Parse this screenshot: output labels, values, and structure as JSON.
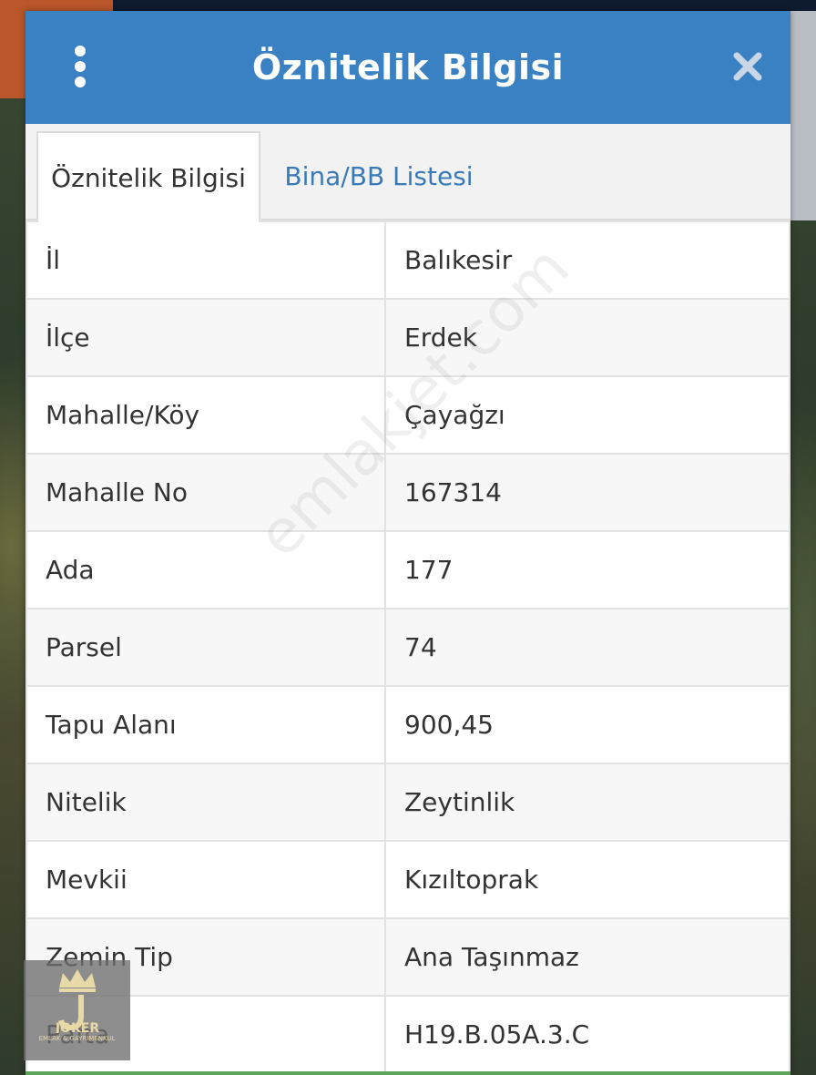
{
  "dialog": {
    "title": "Öznitelik Bilgisi",
    "tabs": [
      {
        "label": "Öznitelik Bilgisi",
        "active": true
      },
      {
        "label": "Bina/BB Listesi",
        "active": false
      }
    ],
    "rows": [
      {
        "key": "İl",
        "value": "Balıkesir"
      },
      {
        "key": "İlçe",
        "value": "Erdek"
      },
      {
        "key": "Mahalle/Köy",
        "value": "Çayağzı"
      },
      {
        "key": "Mahalle No",
        "value": "167314"
      },
      {
        "key": "Ada",
        "value": "177"
      },
      {
        "key": "Parsel",
        "value": "74"
      },
      {
        "key": "Tapu Alanı",
        "value": "900,45"
      },
      {
        "key": "Nitelik",
        "value": "Zeytinlik"
      },
      {
        "key": "Mevkii",
        "value": "Kızıltoprak"
      },
      {
        "key": "Zemin Tip",
        "value": "Ana Taşınmaz"
      },
      {
        "key": "Pafta",
        "value": "H19.B.05A.3.C"
      }
    ]
  },
  "watermark": "emlakjet.com",
  "logo": {
    "name": "JOKER",
    "subtitle": "EMLAK & GAYRİMENKUL"
  },
  "colors": {
    "header": "#3a81c3",
    "tab_link": "#3a7ab8"
  }
}
